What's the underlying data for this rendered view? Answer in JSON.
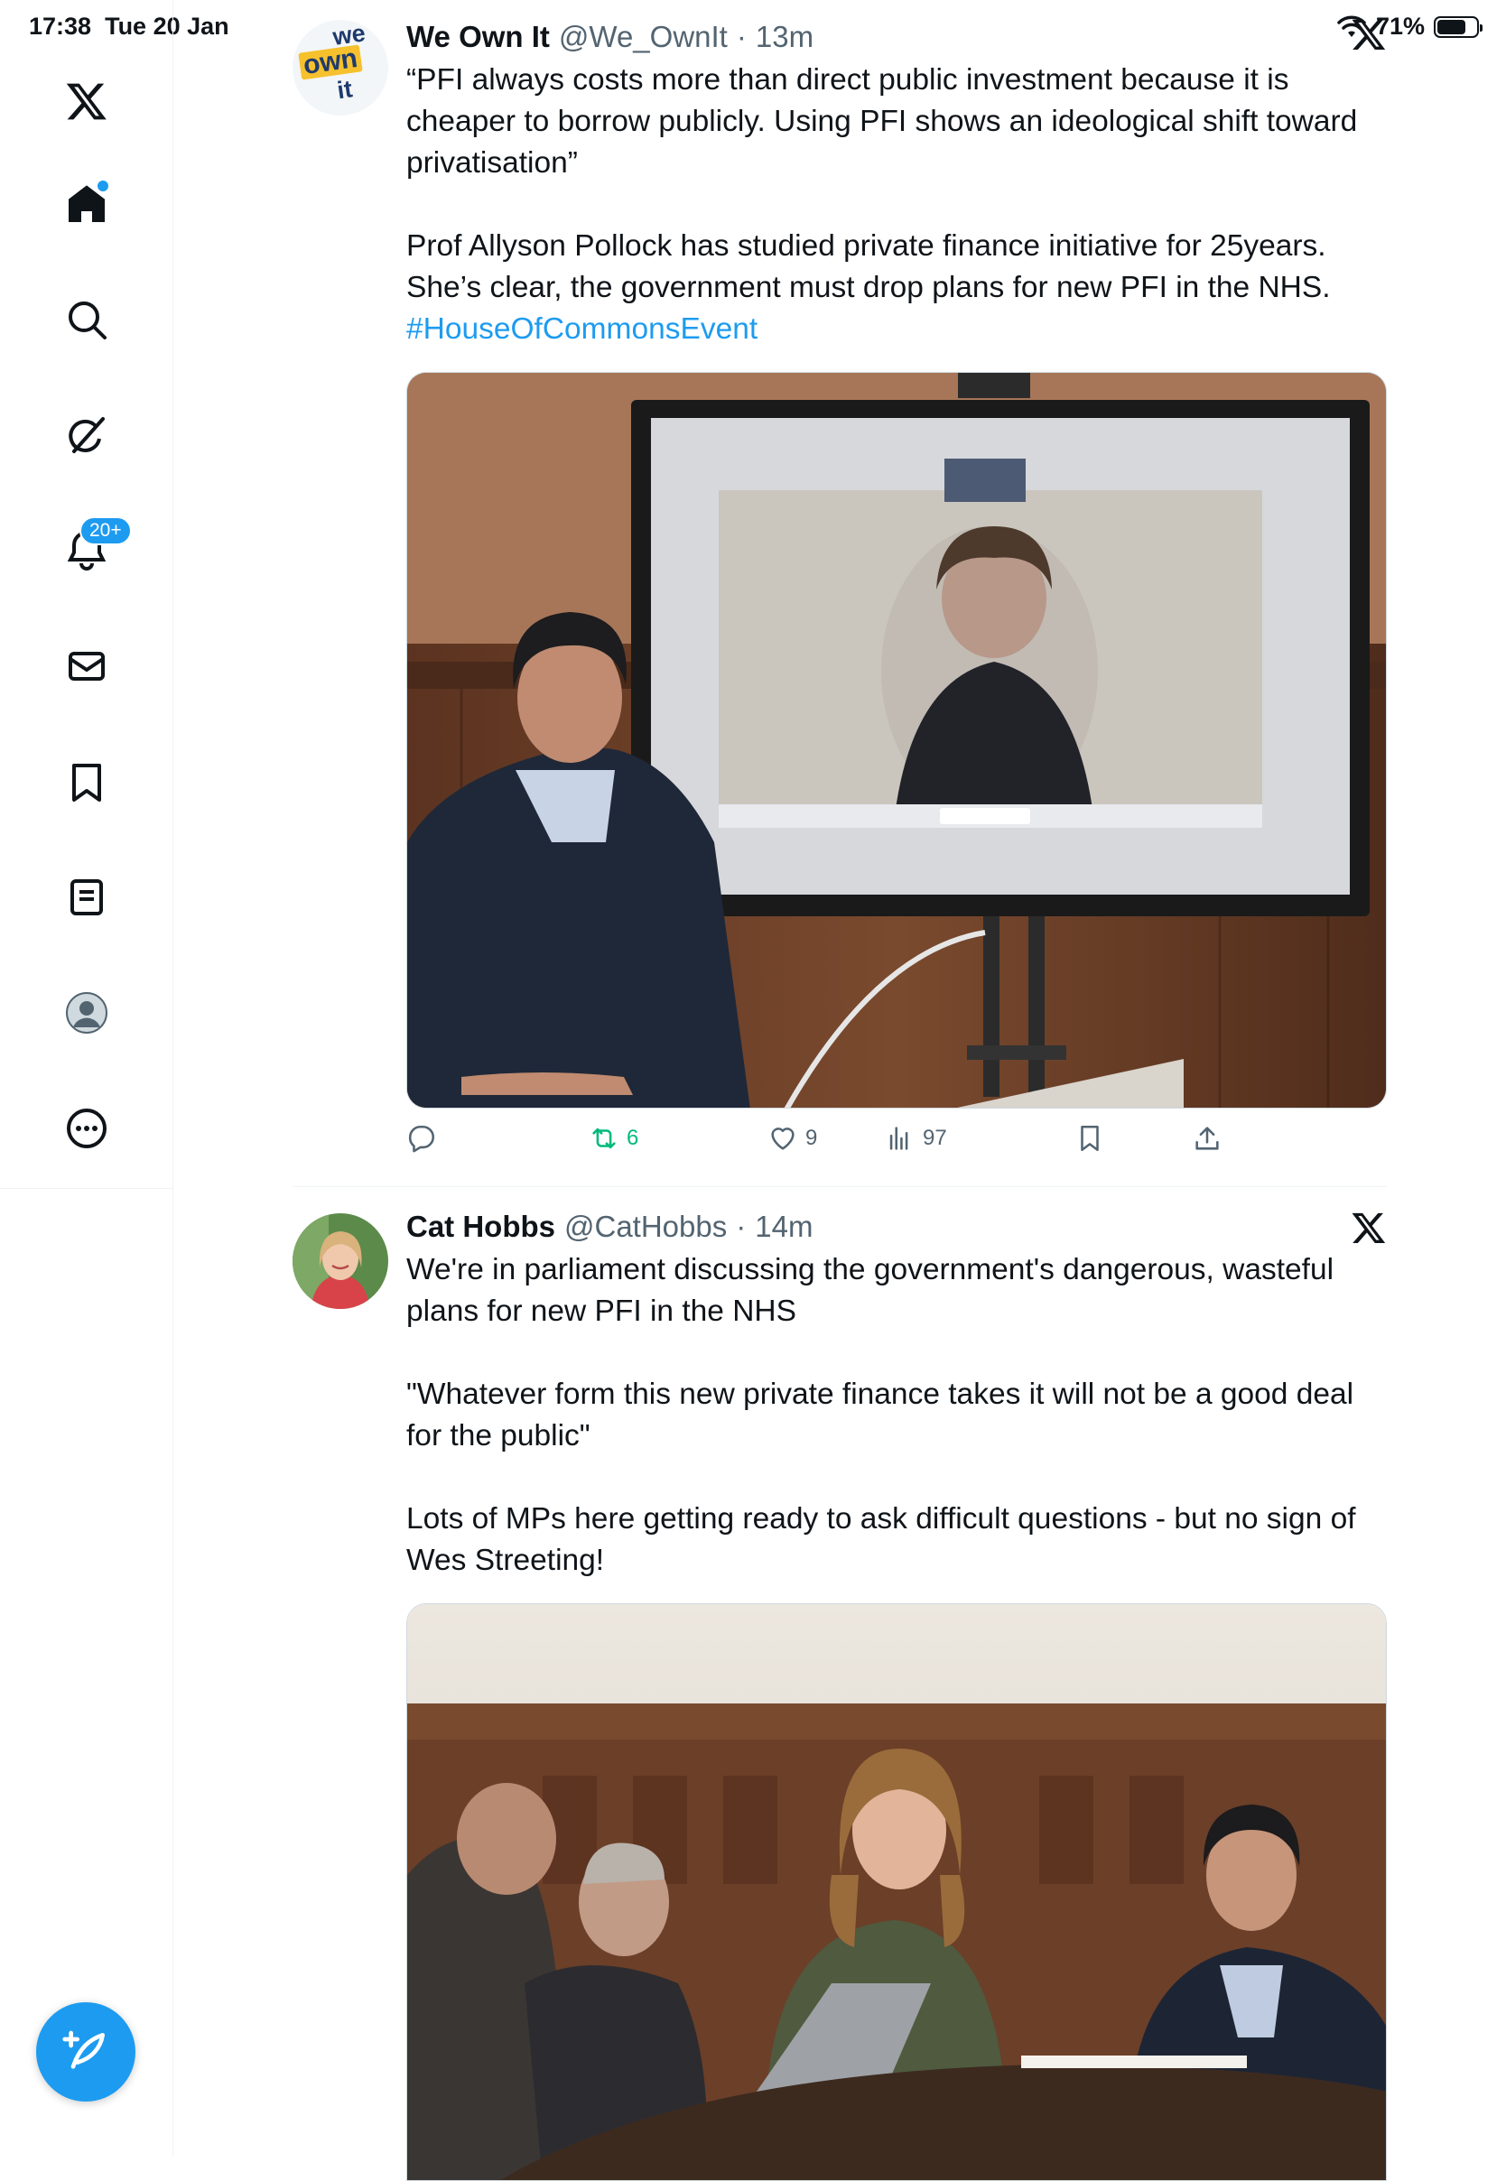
{
  "status": {
    "time": "17:38",
    "date": "Tue 20 Jan",
    "battery": "71%",
    "battery_level": 0.71
  },
  "sidebar": {
    "items": [
      {
        "name": "logo",
        "icon": "x-logo-icon"
      },
      {
        "name": "home",
        "icon": "home-icon",
        "active": true,
        "has_dot": true
      },
      {
        "name": "explore",
        "icon": "search-icon"
      },
      {
        "name": "grok",
        "icon": "grok-icon"
      },
      {
        "name": "notifications",
        "icon": "bell-icon",
        "badge": "20+"
      },
      {
        "name": "messages",
        "icon": "mail-icon"
      },
      {
        "name": "bookmarks",
        "icon": "bookmark-icon"
      },
      {
        "name": "lists",
        "icon": "list-icon"
      },
      {
        "name": "profile",
        "icon": "profile-icon"
      },
      {
        "name": "more",
        "icon": "more-icon"
      }
    ],
    "compose_icon": "compose-icon",
    "accent": "#1d9bf0"
  },
  "tweets": [
    {
      "display_name": "We Own It",
      "handle": "@We_OwnIt",
      "separator": "·",
      "time": "13m",
      "avatar_text": [
        "we",
        "own",
        "it"
      ],
      "text": [
        "“PFI always costs more than direct public investment because it is cheaper to borrow publicly. Using PFI shows an ideological shift toward privatisation”",
        "Prof Allyson Pollock has studied private finance initiative for 25years. She’s clear, the government must drop plans for new PFI in the NHS."
      ],
      "hashtag": "#HouseOfCommonsEvent",
      "media_alt": "Man seated beside a large screen showing a video call with a woman",
      "actions": {
        "reply": "",
        "retweets": "6",
        "likes": "9",
        "views": "97"
      }
    },
    {
      "display_name": "Cat Hobbs",
      "handle": "@CatHobbs",
      "separator": "·",
      "time": "14m",
      "text": [
        "We're in parliament discussing the government's dangerous, wasteful plans for new PFI in the NHS",
        "\"Whatever form this new private finance takes it will not be a good deal for the public\"",
        "Lots of MPs here getting ready to ask difficult questions - but no sign of Wes Streeting!"
      ],
      "media_alt": "People seated around a table in a wood-panelled parliamentary room"
    }
  ],
  "colors": {
    "retweet_green": "#00ba7c",
    "secondary_text": "#536471",
    "link": "#1d9bf0"
  }
}
